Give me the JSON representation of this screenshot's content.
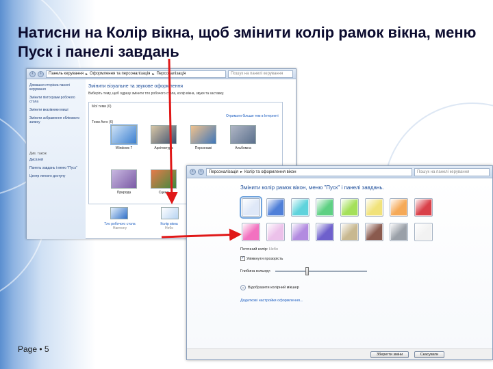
{
  "slide": {
    "title": "Натисни на Колір вікна, щоб змінити колір рамок вікна, меню Пуск і панелі завдань",
    "page_label": "Page • 5"
  },
  "window1": {
    "breadcrumbs": [
      "Панель керування",
      "Оформлення та персоналізація",
      "Персоналізація"
    ],
    "search_placeholder": "Пошук на панелі керування",
    "sidebar_links": [
      "Домашня сторінка панелі керування",
      "Змінити піктограми робочого стола",
      "Змінити вказівники миші",
      "Змінити зображення облікового запису"
    ],
    "see_also_label": "Див. також",
    "see_also_links": [
      "Дисплей",
      "Панель завдань і меню \"Пуск\"",
      "Центр легкого доступу"
    ],
    "heading": "Змінити візуальне та звукове оформлення",
    "description": "Виберіть тему, щоб одразу змінити тло робочого стола, колір вікна, звуки та заставку.",
    "my_themes_label": "Мої теми (0)",
    "online_link": "Отримати більше тем в Інтернеті",
    "aero_label": "Теми Aero (6)",
    "themes": [
      {
        "label": "Windows 7",
        "colors": [
          "#cfe3f7",
          "#3b7fd0"
        ]
      },
      {
        "label": "Архітектура",
        "colors": [
          "#d9c7a6",
          "#3b4e6f"
        ]
      },
      {
        "label": "Персонажі",
        "colors": [
          "#f2c28c",
          "#3f76b9"
        ]
      },
      {
        "label": "Альбомна",
        "colors": [
          "#b0b6c5",
          "#5a6f8c"
        ]
      },
      {
        "label": "Природа",
        "colors": [
          "#c8b8e0",
          "#7a5aa5"
        ]
      },
      {
        "label": "Сцени",
        "colors": [
          "#e67a4a",
          "#3d8a3f"
        ]
      }
    ],
    "bottom_items": [
      {
        "label": "Тло робочого стола",
        "sub": "Harmony"
      },
      {
        "label": "Колір вікна",
        "sub": "Небо"
      }
    ]
  },
  "window2": {
    "breadcrumbs": [
      "Персоналізація",
      "Колір та оформлення вікон"
    ],
    "search_placeholder": "Пошук на панелі керування",
    "heading": "Змінити колір рамок вікон, меню \"Пуск\" і панелі завдань.",
    "swatches": [
      "#dfe8f8",
      "#4f7fd8",
      "#5fd3dc",
      "#5ed083",
      "#a4e05a",
      "#f1e27a",
      "#f5a957",
      "#d9414a",
      "#f272c0",
      "#ecc1ea",
      "#b28be0",
      "#6e60cc",
      "#c8b890",
      "#8a5a4e",
      "#9aa0a8",
      "#f2f2f2"
    ],
    "selected_index": 0,
    "current_color_label": "Поточний колір:",
    "current_color_value": "Небо",
    "transparency_label": "Увімкнути прозорість",
    "transparency_checked": true,
    "intensity_label": "Глибина кольору:",
    "intensity_value": 0.35,
    "mixer_label": "Відобразити колірний мікшер",
    "advanced_link": "Додаткові настройки оформлення...",
    "save_button": "Зберегти зміни",
    "cancel_button": "Скасувати"
  },
  "colors": {
    "accent_link": "#1a5cc0",
    "title_text": "#0b0b2e",
    "arrow": "#e01818"
  }
}
